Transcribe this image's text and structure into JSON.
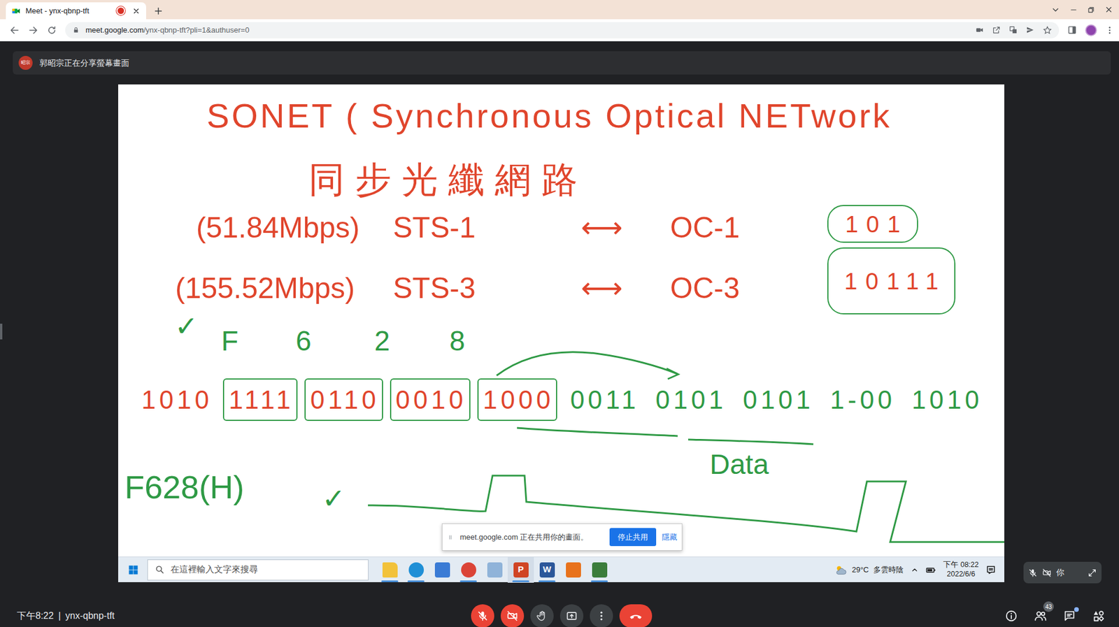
{
  "browser": {
    "tab": {
      "title": "Meet - ynx-qbnp-tft",
      "recording": true,
      "selected": true
    },
    "url_host": "meet.google.com",
    "url_path": "/ynx-qbnp-tft?pli=1&authuser=0"
  },
  "banner": {
    "avatar": "昭宗",
    "text": "郭昭宗正在分享螢幕畫面"
  },
  "whiteboard": {
    "title": "SONET ( Synchronous Optical NETwork",
    "subtitle": "同步光纖網路",
    "rows": [
      {
        "rate": "(51.84Mbps)",
        "sts": "STS-1",
        "arrow": "⟷",
        "oc": "OC-1",
        "bits": "101"
      },
      {
        "rate": "(155.52Mbps)",
        "sts": "STS-3",
        "arrow": "⟷",
        "oc": "OC-3",
        "bits": "10111"
      }
    ],
    "hex_check": "✓",
    "hex_digits": [
      "F",
      "6",
      "2",
      "8"
    ],
    "bit_groups": [
      {
        "bits": "1010",
        "boxed": false,
        "color": "#e0452c"
      },
      {
        "bits": "1111",
        "boxed": true,
        "color": "#e0452c"
      },
      {
        "bits": "0110",
        "boxed": true,
        "color": "#e0452c"
      },
      {
        "bits": "0010",
        "boxed": true,
        "color": "#e0452c"
      },
      {
        "bits": "1000",
        "boxed": true,
        "color": "#e0452c"
      },
      {
        "bits": "0011",
        "boxed": false,
        "color": "#2f9a45"
      },
      {
        "bits": "0101",
        "boxed": false,
        "color": "#2f9a45"
      },
      {
        "bits": "0101",
        "boxed": false,
        "color": "#2f9a45"
      },
      {
        "bits": "1-00",
        "boxed": false,
        "color": "#2f9a45"
      },
      {
        "bits": "1010",
        "boxed": false,
        "color": "#2f9a45"
      }
    ],
    "data_label": "Data",
    "hex_value": "F628(H)",
    "value_check": "✓"
  },
  "taskbar": {
    "search_placeholder": "在這裡輸入文字來搜尋",
    "apps": [
      {
        "kind": "folder",
        "color": "#f2c23a",
        "running": true,
        "letter": ""
      },
      {
        "kind": "edge",
        "color": "#1f8fd6",
        "running": true,
        "letter": ""
      },
      {
        "kind": "store",
        "color": "#3a7bd5",
        "running": false,
        "letter": ""
      },
      {
        "kind": "chrome",
        "color": "#db4437",
        "running": true,
        "letter": ""
      },
      {
        "kind": "paint",
        "color": "#8fb3d9",
        "running": false,
        "letter": ""
      },
      {
        "kind": "powerpoint",
        "color": "#d04423",
        "running": true,
        "letter": "P"
      },
      {
        "kind": "word",
        "color": "#2b579a",
        "running": true,
        "letter": "W"
      },
      {
        "kind": "matlab",
        "color": "#e8721c",
        "running": false,
        "letter": ""
      },
      {
        "kind": "game",
        "color": "#3b7d3b",
        "running": true,
        "letter": ""
      }
    ],
    "weather": {
      "temp": "29°C",
      "desc": "多雲時陰"
    },
    "time": "下午 08:22",
    "date": "2022/6/6"
  },
  "share_notice": {
    "text": "meet.google.com 正在共用你的畫面。",
    "stop": "停止共用",
    "hide": "隱藏"
  },
  "self_view": {
    "label": "你",
    "mic_muted": true,
    "cam_off": true
  },
  "bottom_bar": {
    "time": "下午8:22",
    "separator": "|",
    "meeting_code": "ynx-qbnp-tft",
    "mic_muted": true,
    "cam_off": true,
    "participants": "43",
    "chat_unread": true
  }
}
